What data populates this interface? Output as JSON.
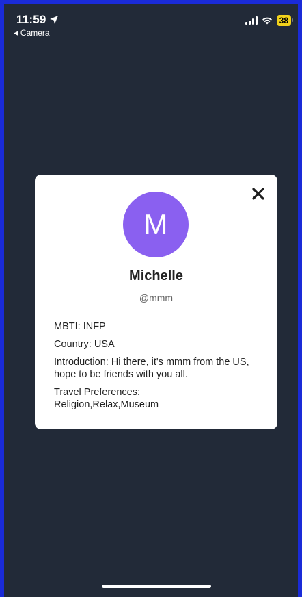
{
  "status_bar": {
    "time": "11:59",
    "back_label": "Camera",
    "battery": "38",
    "location_icon": "location-arrow-icon",
    "signal_icon": "cellular-signal-icon",
    "wifi_icon": "wifi-icon"
  },
  "profile": {
    "avatar_initial": "M",
    "avatar_color": "#8a60f0",
    "name": "Michelle",
    "handle": "@mmm",
    "mbti": "MBTI: INFP",
    "country": "Country: USA",
    "introduction": "Introduction: Hi there, it's mmm from the US, hope to be friends with you all.",
    "travel_label": "Travel Preferences:",
    "travel_values": "Religion,Relax,Museum"
  },
  "colors": {
    "background": "#222a38",
    "frame": "#1a2bd8",
    "card": "#ffffff",
    "battery": "#f2d21b"
  }
}
